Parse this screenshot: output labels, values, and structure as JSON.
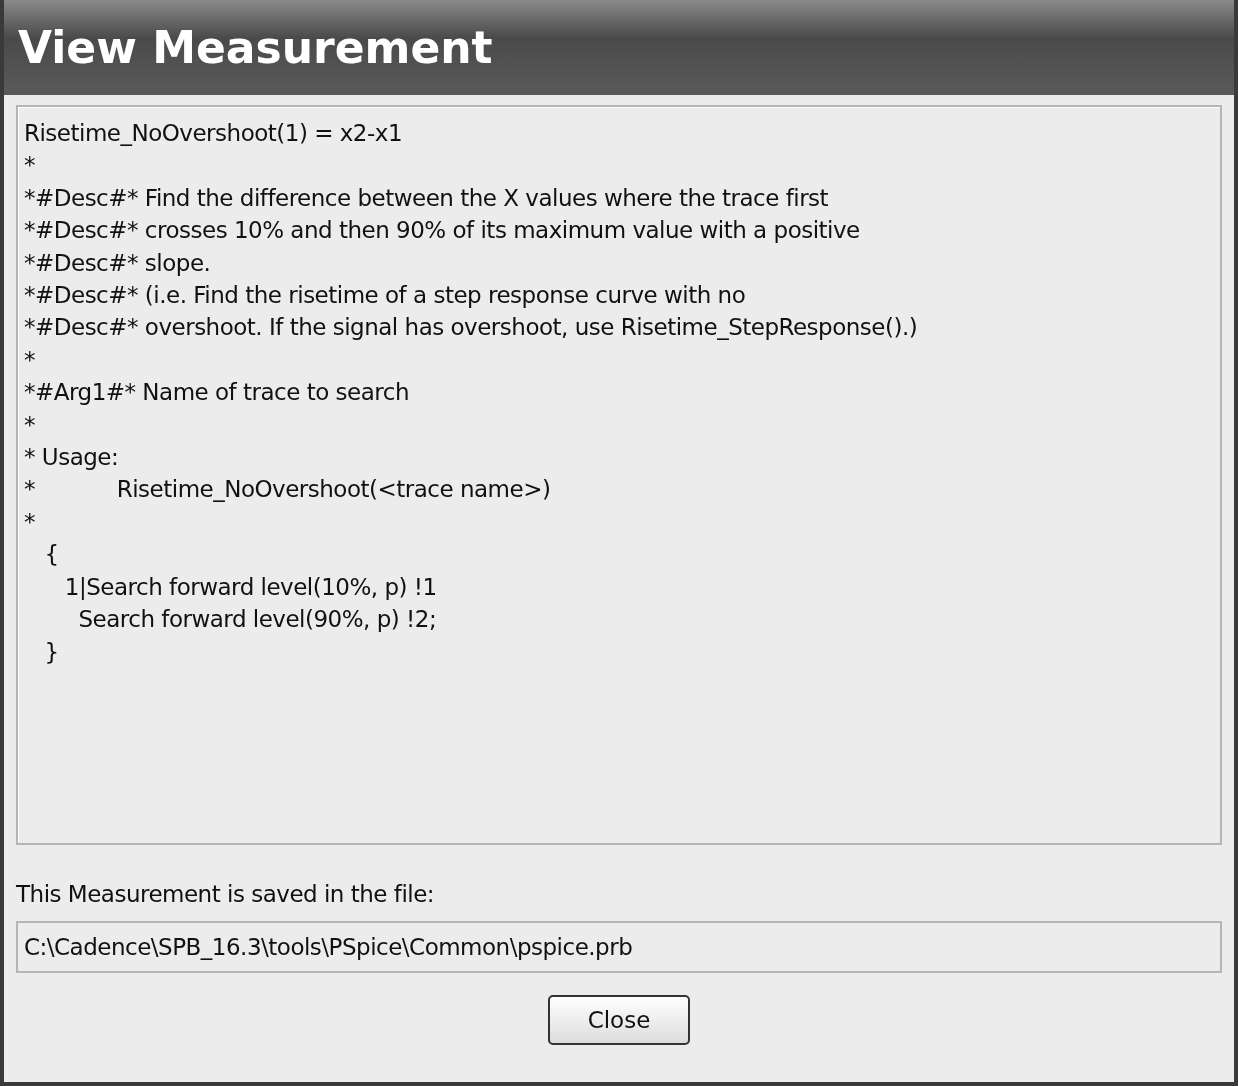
{
  "window": {
    "title": "View Measurement"
  },
  "definition": {
    "lines": [
      "Risetime_NoOvershoot(1) = x2-x1",
      "*",
      "*#Desc#* Find the difference between the X values where the trace first",
      "*#Desc#* crosses 10% and then 90% of its maximum value with a positive",
      "*#Desc#* slope.",
      "*#Desc#* (i.e. Find the risetime of a step response curve with no",
      "*#Desc#* overshoot. If the signal has overshoot, use Risetime_StepResponse().)",
      "*",
      "*#Arg1#* Name of trace to search",
      "*",
      "* Usage:",
      "*            Risetime_NoOvershoot(<trace name>)",
      "*",
      "   {",
      "      1|Search forward level(10%, p) !1",
      "        Search forward level(90%, p) !2;",
      "   }"
    ]
  },
  "file_label": "This Measurement is saved in the file:",
  "file_path": {
    "value": "C:\\Cadence\\SPB_16.3\\tools\\PSpice\\Common\\pspice.prb"
  },
  "buttons": [
    "Close"
  ]
}
